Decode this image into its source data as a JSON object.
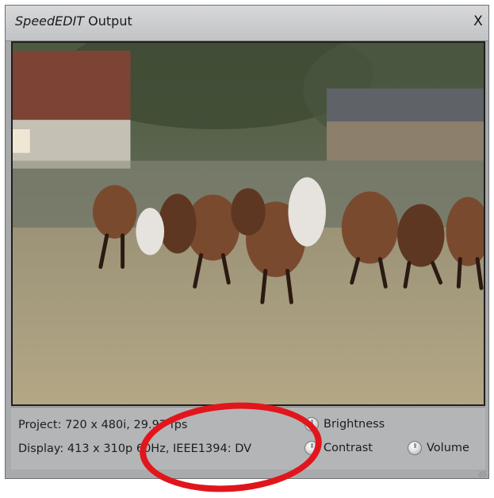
{
  "window": {
    "title_brand": "SpeedEDIT",
    "title_rest": " Output",
    "close_label": "X"
  },
  "info": {
    "project_line": "Project: 720 x 480i, 29.97 fps",
    "display_line": "Display: 413 x 310p 60Hz, IEEE1394: DV"
  },
  "controls": {
    "brightness_label": "Brightness",
    "contrast_label": "Contrast",
    "volume_label": "Volume"
  },
  "annotation_color": "#e1161c"
}
